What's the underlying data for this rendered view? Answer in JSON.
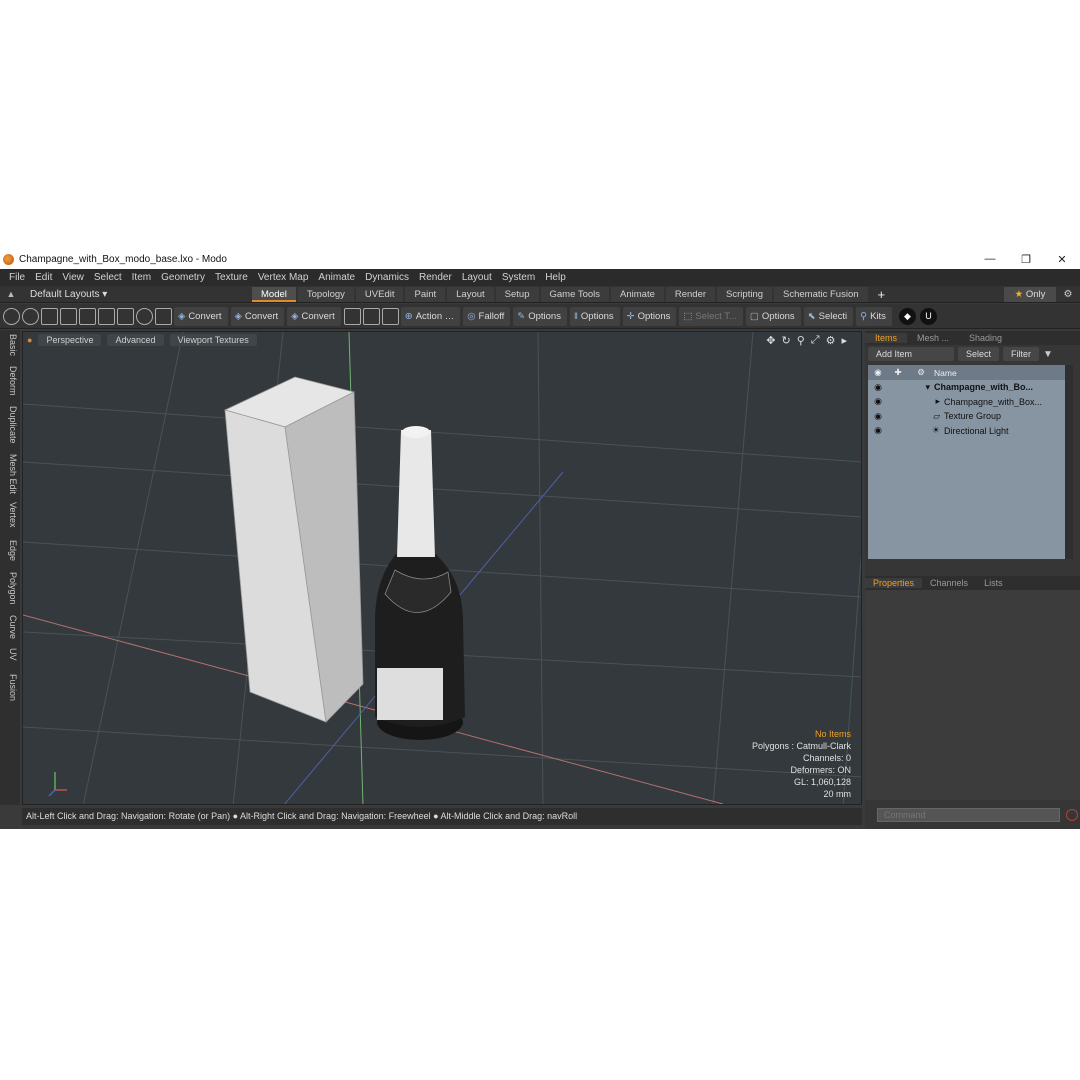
{
  "window": {
    "title": "Champagne_with_Box_modo_base.lxo - Modo",
    "min_glyph": "—",
    "max_glyph": "❐",
    "close_glyph": "✕"
  },
  "menu": [
    "File",
    "Edit",
    "View",
    "Select",
    "Item",
    "Geometry",
    "Texture",
    "Vertex Map",
    "Animate",
    "Dynamics",
    "Render",
    "Layout",
    "System",
    "Help"
  ],
  "layout_bar": {
    "layouts_label": "Default Layouts ▾",
    "tabs": [
      "Model",
      "Topology",
      "UVEdit",
      "Paint",
      "Layout",
      "Setup",
      "Game Tools",
      "Animate",
      "Render",
      "Scripting",
      "Schematic Fusion"
    ],
    "active_tab": "Model",
    "add_glyph": "+",
    "only_label": "Only"
  },
  "toolbar": {
    "buttons": [
      "Convert",
      "Convert",
      "Convert",
      "Action",
      "Falloff",
      "Options",
      "Options",
      "Options",
      "Select T...",
      "Options",
      "Selecti",
      "Kits"
    ]
  },
  "left_tabs": [
    "Basic",
    "Deform",
    "Duplicate",
    "Mesh Edit",
    "Vertex",
    "Edge",
    "Polygon",
    "Curve",
    "UV",
    "Fusion"
  ],
  "viewport": {
    "buttons": [
      "Perspective",
      "Advanced",
      "Viewport Textures"
    ],
    "info": {
      "selection": "No Items",
      "polygons": "Polygons : Catmull-Clark",
      "channels": "Channels: 0",
      "deformers": "Deformers: ON",
      "gl": "GL: 1,060,128",
      "unit": "20 mm"
    }
  },
  "status_bar": "Alt-Left Click and Drag: Navigation: Rotate (or Pan) ● Alt-Right Click and Drag: Navigation: Freewheel ● Alt-Middle Click and Drag: navRoll",
  "right_panel": {
    "tabs": [
      "Items",
      "Mesh ...",
      "Shading"
    ],
    "active_tab": "Items",
    "add_item": "Add Item",
    "select": "Select",
    "filter": "Filter",
    "column_name": "Name",
    "items": [
      {
        "label": "Champagne_with_Bo...",
        "indent": 0
      },
      {
        "label": "Champagne_with_Box...",
        "indent": 1
      },
      {
        "label": "Texture Group",
        "indent": 1
      },
      {
        "label": "Directional Light",
        "indent": 1
      }
    ],
    "lower_tabs": [
      "Properties",
      "Channels",
      "Lists"
    ],
    "lower_active": "Properties",
    "command_placeholder": "Command"
  },
  "colors": {
    "accent": "#e08a2a",
    "viewport_bg": "#33393c",
    "items_bg": "#8795a3",
    "info_highlight": "#f0a020"
  }
}
